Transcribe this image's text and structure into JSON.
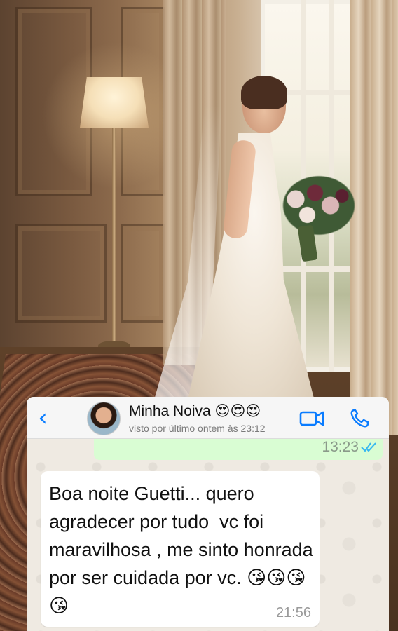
{
  "header": {
    "back_label": "‹",
    "contact_name": "Minha Noiva 😍😍😍",
    "status": "visto por último ontem às 23:12"
  },
  "messages": {
    "sent_partial": {
      "time": "13:23",
      "status": "read"
    },
    "received": {
      "text": "Boa noite Guetti... quero agradecer por tudo  vc foi maravilhosa , me sinto honrada por ser cuidada por vc. 😘😘😘😘",
      "time": "21:56"
    }
  },
  "colors": {
    "accent": "#0a7cff",
    "sent_bubble": "#d9fdd3",
    "received_bubble": "#ffffff",
    "chat_background": "#efeae2",
    "read_ticks": "#34b7f1"
  },
  "icons": [
    "back-chevron-icon",
    "video-call-icon",
    "phone-call-icon",
    "double-check-icon"
  ]
}
